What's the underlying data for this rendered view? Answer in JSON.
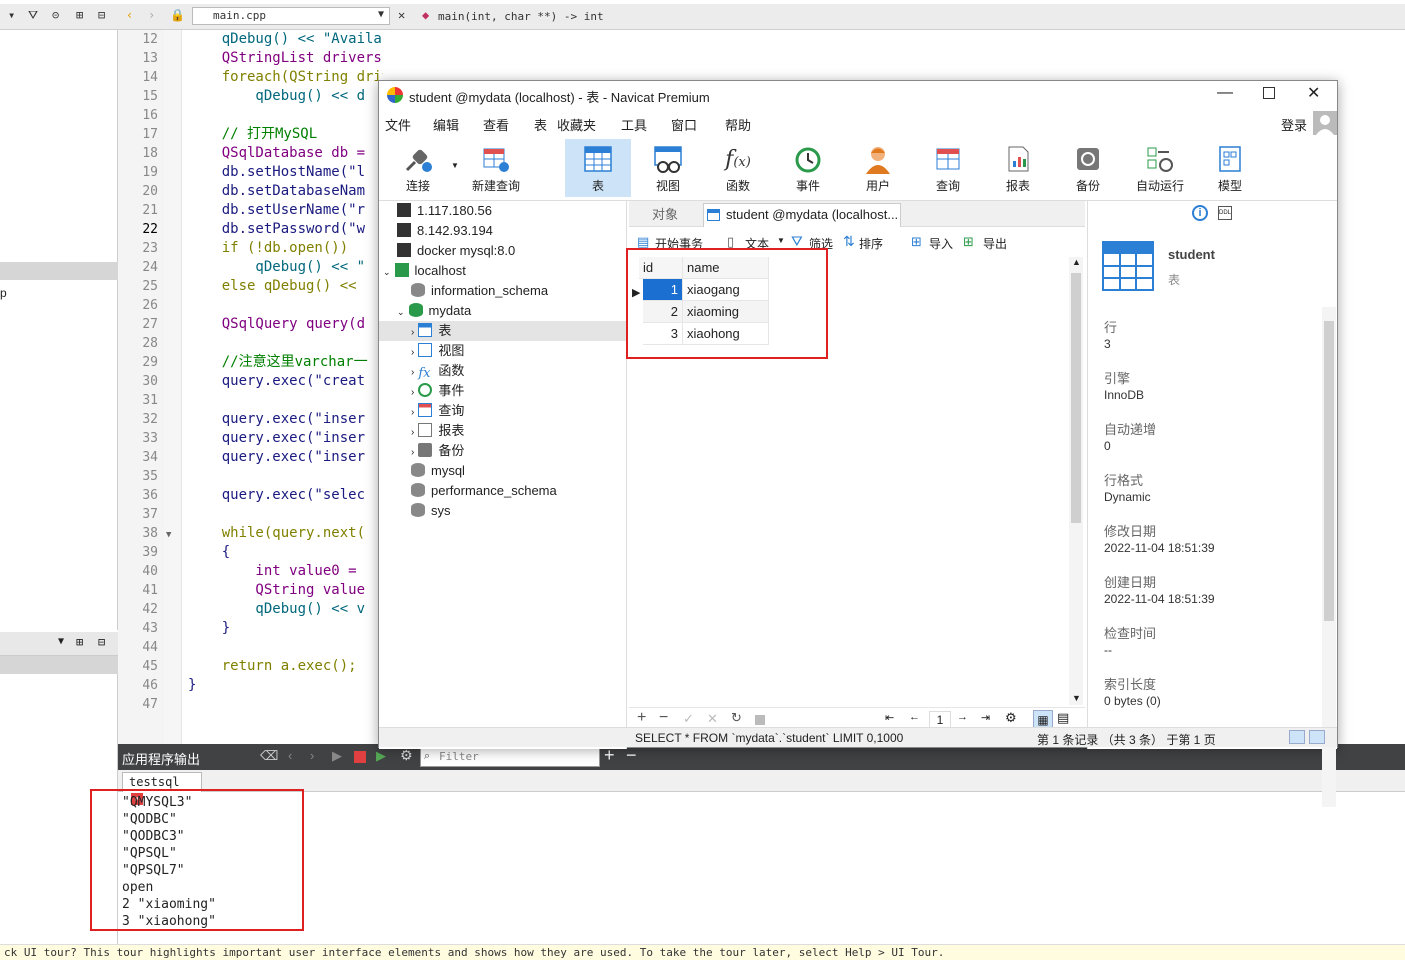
{
  "ide": {
    "file_tab": "main.cpp",
    "function_sig": "main(int, char **) -> int",
    "left_fragment": "p",
    "line_numbers": [
      "12",
      "13",
      "14",
      "15",
      "16",
      "17",
      "18",
      "19",
      "20",
      "21",
      "22",
      "23",
      "24",
      "25",
      "26",
      "27",
      "28",
      "29",
      "30",
      "31",
      "32",
      "33",
      "34",
      "35",
      "36",
      "37",
      "38",
      "39",
      "40",
      "41",
      "42",
      "43",
      "44",
      "45",
      "46",
      "47"
    ],
    "code_lines": [
      "    qDebug() << \"Available drivers:\";",
      "    QStringList drivers = QSqlDatabase::drivers();",
      "    foreach(QString driver, drivers)",
      "        qDebug() << d",
      "",
      "    // 打开MySQL",
      "    QSqlDatabase db =",
      "    db.setHostName(\"l",
      "    db.setDatabaseNam",
      "    db.setUserName(\"r",
      "    db.setPassword(\"w",
      "    if (!db.open())",
      "        qDebug() << \"",
      "    else qDebug() <<",
      "",
      "    QSqlQuery query(d",
      "",
      "    //注意这里varchar一",
      "    query.exec(\"creat",
      "",
      "    query.exec(\"inser",
      "    query.exec(\"inser",
      "    query.exec(\"inser",
      "",
      "    query.exec(\"selec",
      "",
      "    while(query.next(",
      "    {",
      "        int value0 =",
      "        QString value",
      "        qDebug() << v",
      "    }",
      "",
      "    return a.exec();",
      "}",
      ""
    ],
    "output_title": "应用程序输出",
    "filter_placeholder": "Filter",
    "output_tab": "testsql",
    "output_lines": [
      "\"QMYSQL3\"",
      "\"QODBC\"",
      "\"QODBC3\"",
      "\"QPSQL\"",
      "\"QPSQL7\"",
      "open",
      "2 \"xiaoming\"",
      "3 \"xiaohong\""
    ],
    "status_text": "ck UI tour? This tour highlights important user interface elements and shows how they are used. To take the tour later, select Help > UI Tour."
  },
  "navicat": {
    "title": "student @mydata (localhost) - 表 - Navicat Premium",
    "menu": [
      "文件",
      "编辑",
      "查看",
      "表",
      "收藏夹",
      "工具",
      "窗口",
      "帮助"
    ],
    "login": "登录",
    "toolbar": [
      "连接",
      "新建查询",
      "表",
      "视图",
      "函数",
      "事件",
      "用户",
      "查询",
      "报表",
      "备份",
      "自动运行",
      "模型"
    ],
    "tree": {
      "connections": [
        "1.117.180.56",
        "8.142.93.194",
        "docker mysql:8.0",
        "localhost"
      ],
      "databases_top": [
        "information_schema",
        "mydata"
      ],
      "mydata_children": [
        "表",
        "视图",
        "函数",
        "事件",
        "查询",
        "报表",
        "备份"
      ],
      "databases_bottom": [
        "mysql",
        "performance_schema",
        "sys"
      ]
    },
    "tabs": {
      "objects": "对象",
      "active": "student @mydata (localhost..."
    },
    "actions": [
      "开始事务",
      "文本",
      "筛选",
      "排序",
      "导入",
      "导出"
    ],
    "grid": {
      "columns": [
        "id",
        "name"
      ],
      "rows": [
        [
          "1",
          "xiaogang"
        ],
        [
          "2",
          "xiaoming"
        ],
        [
          "3",
          "xiaohong"
        ]
      ]
    },
    "page_number": "1",
    "sql": "SELECT * FROM `mydata`.`student` LIMIT 0,1000",
    "record_info": "第 1 条记录 （共 3 条） 于第 1 页",
    "info": {
      "name": "student",
      "type": "表",
      "fields": [
        {
          "label": "行",
          "value": "3"
        },
        {
          "label": "引擎",
          "value": "InnoDB"
        },
        {
          "label": "自动递增",
          "value": "0"
        },
        {
          "label": "行格式",
          "value": "Dynamic"
        },
        {
          "label": "修改日期",
          "value": "2022-11-04 18:51:39"
        },
        {
          "label": "创建日期",
          "value": "2022-11-04 18:51:39"
        },
        {
          "label": "检查时间",
          "value": "--"
        },
        {
          "label": "索引长度",
          "value": "0 bytes (0)"
        }
      ]
    }
  }
}
